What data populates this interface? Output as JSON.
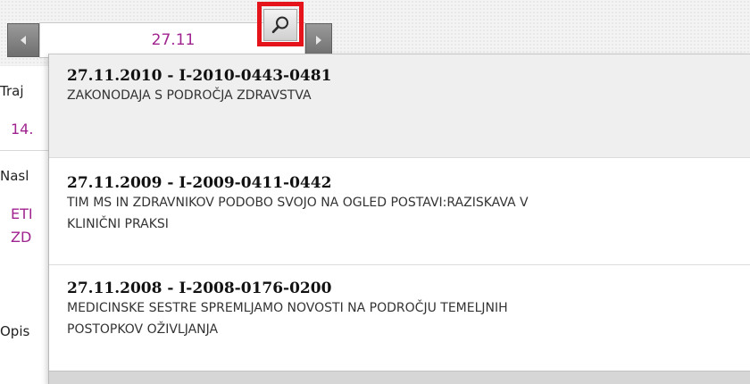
{
  "search": {
    "value": "27.11"
  },
  "form": {
    "labels": {
      "trajanje": "Traj",
      "naslov": "Nasl",
      "opis": "Opis"
    },
    "values": {
      "trajanje": "14.",
      "naslov_line1": "ETI",
      "naslov_line2": "ZD"
    }
  },
  "results": [
    {
      "title": "27.11.2010 - I-2010-0443-0481",
      "desc_line1": "ZAKONODAJA S PODROČJA ZDRAVSTVA",
      "desc_line2": ""
    },
    {
      "title": "27.11.2009 - I-2009-0411-0442",
      "desc_line1": "TIM MS IN ZDRAVNIKOV PODOBO SVOJO NA OGLED POSTAVI:RAZISKAVA V",
      "desc_line2": "KLINIČNI PRAKSI"
    },
    {
      "title": "27.11.2008 - I-2008-0176-0200",
      "desc_line1": "MEDICINSKE SESTRE SPREMLJAMO NOVOSTI NA PODROČJU TEMELJNIH",
      "desc_line2": "POSTOPKOV OŽIVLJANJA"
    }
  ],
  "colors": {
    "accent": "#a0248f",
    "highlight_border": "#e5141b"
  },
  "icons": {
    "search": "magnifier-icon",
    "prev": "chevron-left-icon",
    "next": "chevron-right-icon"
  }
}
